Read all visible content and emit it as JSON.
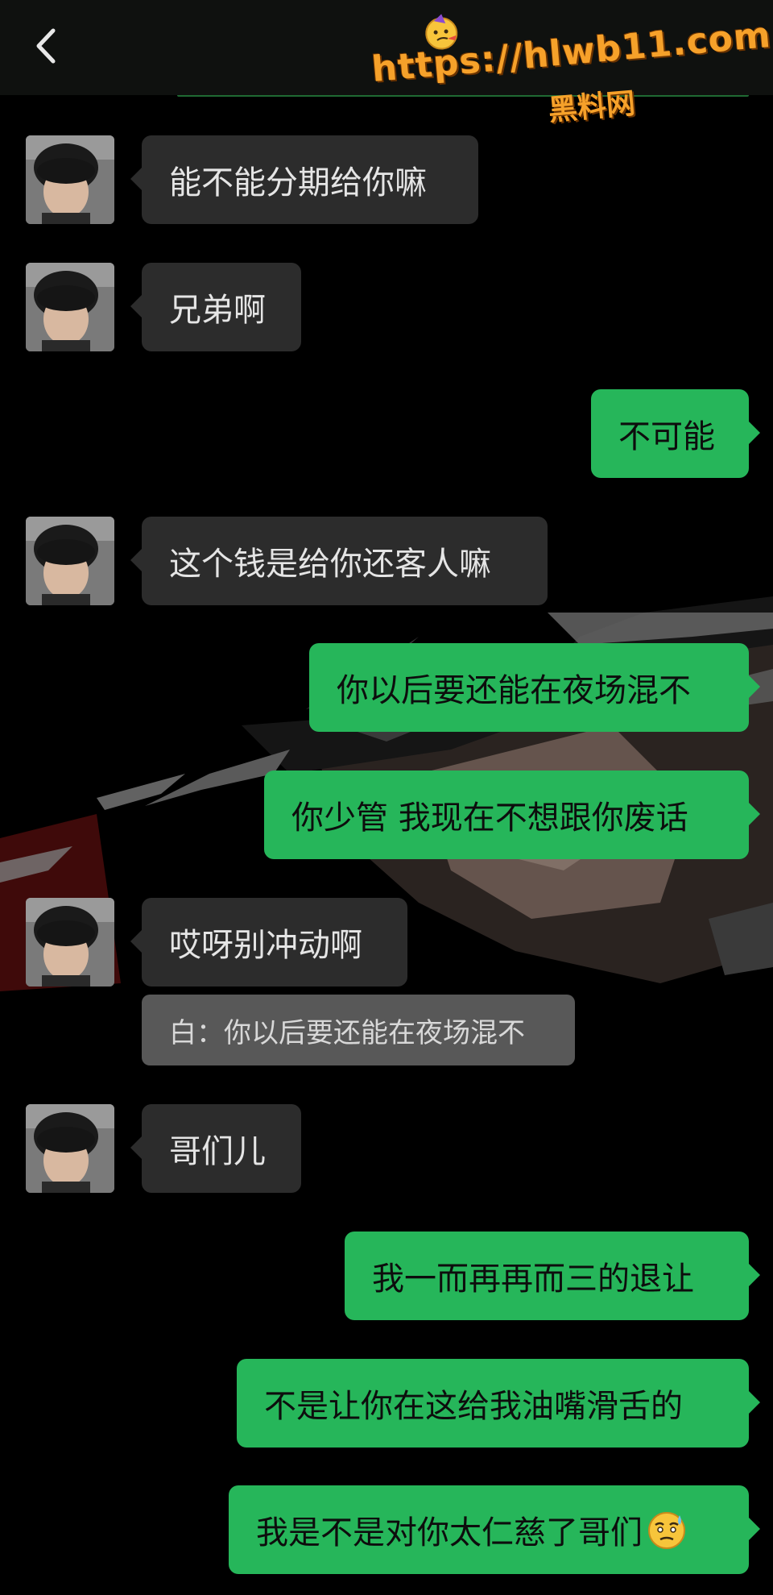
{
  "watermark": {
    "url": "https://hlwb11.com",
    "subtitle": "黑料网",
    "emoji": "party-face-emoji"
  },
  "topbar": {
    "back_icon": "chevron-left-icon"
  },
  "messages": [
    {
      "side": "in",
      "text": "能不能分期给你嘛",
      "avatar": "contact-avatar"
    },
    {
      "side": "in",
      "text": "兄弟啊",
      "avatar": "contact-avatar"
    },
    {
      "side": "out",
      "text": "不可能"
    },
    {
      "side": "in",
      "text": "这个钱是给你还客人嘛",
      "avatar": "contact-avatar"
    },
    {
      "side": "out",
      "text": "你以后要还能在夜场混不"
    },
    {
      "side": "out",
      "text": "你少管 我现在不想跟你废话"
    },
    {
      "side": "in",
      "text": "哎呀别冲动啊",
      "avatar": "contact-avatar"
    },
    {
      "side": "in",
      "text": "哥们儿",
      "avatar": "contact-avatar"
    },
    {
      "side": "out",
      "text": "我一而再再而三的退让"
    },
    {
      "side": "out",
      "text": "不是让你在这给我油嘴滑舌的"
    },
    {
      "side": "out",
      "text": "我是不是对你太仁慈了哥们",
      "emoji": "sweat-smile-emoji"
    }
  ],
  "quoted_reply": {
    "text": "白：你以后要还能在夜场混不"
  },
  "colors": {
    "background": "#000000",
    "incoming_bubble": "#2c2c2c",
    "outgoing_bubble": "#26b65a",
    "quote_bubble": "#585858",
    "watermark": "#f6a12a"
  }
}
